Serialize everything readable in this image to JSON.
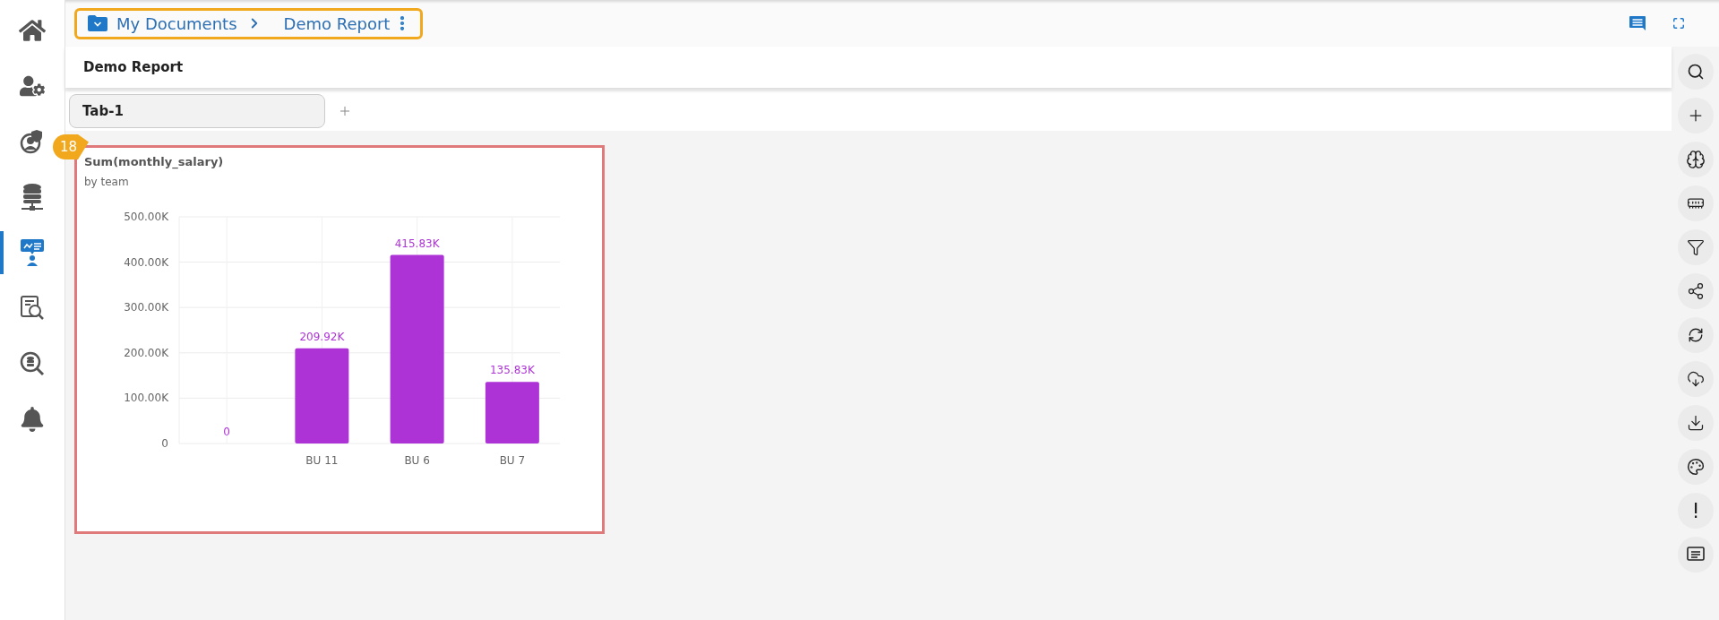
{
  "sidebar": {
    "items": [
      {
        "selected": false
      },
      {
        "selected": false
      },
      {
        "selected": false
      },
      {
        "selected": false
      },
      {
        "selected": true
      },
      {
        "selected": false
      },
      {
        "selected": false
      },
      {
        "selected": false
      }
    ]
  },
  "breadcrumb": {
    "items": [
      "My Documents",
      "Demo Report"
    ]
  },
  "report": {
    "title": "Demo Report"
  },
  "tabs": [
    {
      "label": "Tab-1",
      "selected": true
    }
  ],
  "widget": {
    "badge": "18",
    "title": "Sum(monthly_salary)",
    "subtitle": "by team",
    "chart_data": {
      "type": "bar",
      "categories": [
        null,
        "BU 11",
        "BU 6",
        "BU 7"
      ],
      "series": [
        {
          "color": "#ad33d6",
          "values": [
            0,
            209920,
            415830,
            135830
          ]
        }
      ],
      "grid": true,
      "ylim": [
        0,
        500000
      ],
      "yticks": [
        {
          "value": 0,
          "label": "0"
        },
        {
          "value": 100000,
          "label": "100.00K"
        },
        {
          "value": 200000,
          "label": "200.00K"
        },
        {
          "value": 300000,
          "label": "300.00K"
        },
        {
          "value": 400000,
          "label": "400.00K"
        },
        {
          "value": 500000,
          "label": "500.00K"
        }
      ],
      "value_labels": [
        "0",
        "209.92K",
        "415.83K",
        "135.83K"
      ]
    }
  }
}
